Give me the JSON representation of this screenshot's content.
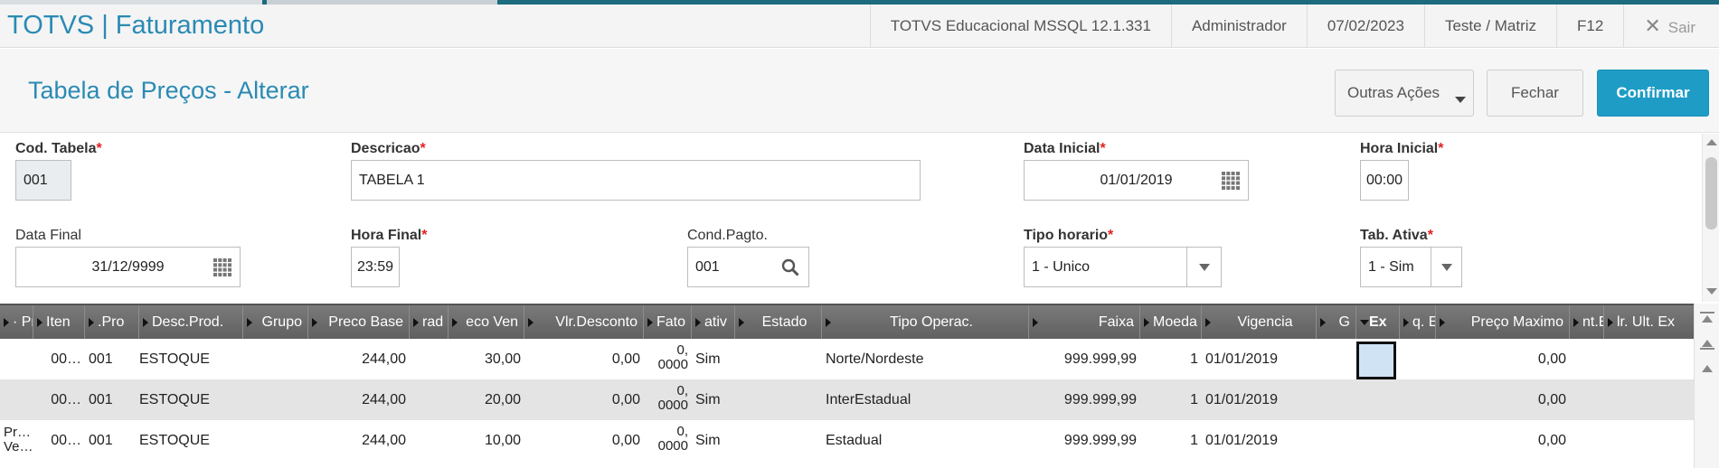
{
  "app": {
    "title": "TOTVS | Faturamento",
    "system": "TOTVS Educacional MSSQL 12.1.331",
    "user": "Administrador",
    "date": "07/02/2023",
    "branch": "Teste / Matriz",
    "help": "F12",
    "exit_label": "Sair"
  },
  "page": {
    "title": "Tabela de Preços - Alterar",
    "actions": {
      "more": "Outras Ações",
      "close": "Fechar",
      "confirm": "Confirmar"
    }
  },
  "form": {
    "cod_tabela": {
      "label": "Cod. Tabela",
      "value": "001"
    },
    "descricao": {
      "label": "Descricao",
      "value": "TABELA 1"
    },
    "data_inicial": {
      "label": "Data Inicial",
      "value": "01/01/2019"
    },
    "hora_inicial": {
      "label": "Hora Inicial",
      "value": "00:00"
    },
    "data_final": {
      "label": "Data Final",
      "value": "31/12/9999"
    },
    "hora_final": {
      "label": "Hora Final",
      "value": "23:59"
    },
    "cond_pagto": {
      "label": "Cond.Pagto.",
      "value": "001"
    },
    "tipo_horario": {
      "label": "Tipo horario",
      "value": "1 - Unico"
    },
    "tab_ativa": {
      "label": "Tab. Ativa",
      "value": "1 - Sim"
    },
    "required_mark": "*"
  },
  "grid": {
    "headers": [
      "· Pr",
      "Iten",
      ".Pro",
      "Desc.Prod.",
      "Grupo",
      "Preco Base",
      "rad",
      "eco Ven",
      "Vlr.Desconto",
      "Fato",
      "ativ",
      "Estado",
      "Tipo Operac.",
      "Faixa",
      "Moeda",
      "Vigencia",
      "G",
      "Ex",
      "q. E",
      "Preço Maximo",
      "nt.E",
      "lr. Ult. Ex"
    ],
    "rows": [
      {
        "c0": "",
        "c1": "00…",
        "c2": "001",
        "c3": "ESTOQUE",
        "c5": "244,00",
        "c7": "30,00",
        "c8": "0,00",
        "c9a": "0,",
        "c9b": "0000",
        "c10": "Sim",
        "c12": "Norte/Nordeste",
        "c13": "999.999,99",
        "c14": "1",
        "c15": "01/01/2019",
        "c19": "0,00"
      },
      {
        "c0": "",
        "c1": "00…",
        "c2": "001",
        "c3": "ESTOQUE",
        "c5": "244,00",
        "c7": "20,00",
        "c8": "0,00",
        "c9a": "0,",
        "c9b": "0000",
        "c10": "Sim",
        "c12": "InterEstadual",
        "c13": "999.999,99",
        "c14": "1",
        "c15": "01/01/2019",
        "c19": "0,00"
      },
      {
        "c0a": "Pr…",
        "c0b": "Ve…",
        "c1": "00…",
        "c2": "001",
        "c3": "ESTOQUE",
        "c5": "244,00",
        "c7": "10,00",
        "c8": "0,00",
        "c9a": "0,",
        "c9b": "0000",
        "c10": "Sim",
        "c12": "Estadual",
        "c13": "999.999,99",
        "c14": "1",
        "c15": "01/01/2019",
        "c19": "0,00"
      }
    ]
  },
  "colors": {
    "accent": "#2a8ab4",
    "confirm": "#1e9cc6",
    "required": "#e02020"
  }
}
